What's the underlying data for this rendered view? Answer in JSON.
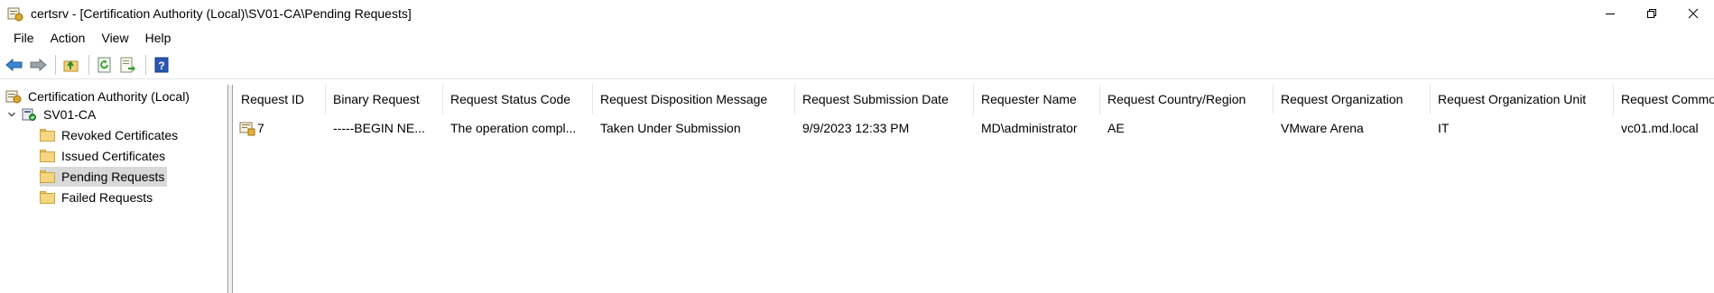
{
  "window": {
    "title": "certsrv - [Certification Authority (Local)\\SV01-CA\\Pending Requests]",
    "controls": [
      "minimize",
      "restore",
      "close"
    ]
  },
  "menu": [
    "File",
    "Action",
    "View",
    "Help"
  ],
  "toolbar": {
    "buttons": [
      "back-arrow-icon",
      "forward-arrow-icon",
      "up-folder-icon",
      "refresh-icon",
      "export-list-icon",
      "help-icon"
    ]
  },
  "tree": {
    "root": "Certification Authority (Local)",
    "ca": "SV01-CA",
    "folders": [
      "Revoked Certificates",
      "Issued Certificates",
      "Pending Requests",
      "Failed Requests"
    ],
    "selected": "Pending Requests"
  },
  "list": {
    "columns": [
      "Request ID",
      "Binary Request",
      "Request Status Code",
      "Request Disposition Message",
      "Request Submission Date",
      "Requester Name",
      "Request Country/Region",
      "Request Organization",
      "Request Organization Unit",
      "Request Common Name"
    ],
    "rows": [
      {
        "cells": [
          "7",
          "-----BEGIN NE...",
          "The operation compl...",
          "Taken Under Submission",
          "9/9/2023 12:33 PM",
          "MD\\administrator",
          "AE",
          "VMware Arena",
          "IT",
          "vc01.md.local"
        ]
      }
    ]
  },
  "colors": {
    "selection": "#d9d9d9",
    "folder": "#f5d782",
    "border": "#a0a0a0"
  }
}
